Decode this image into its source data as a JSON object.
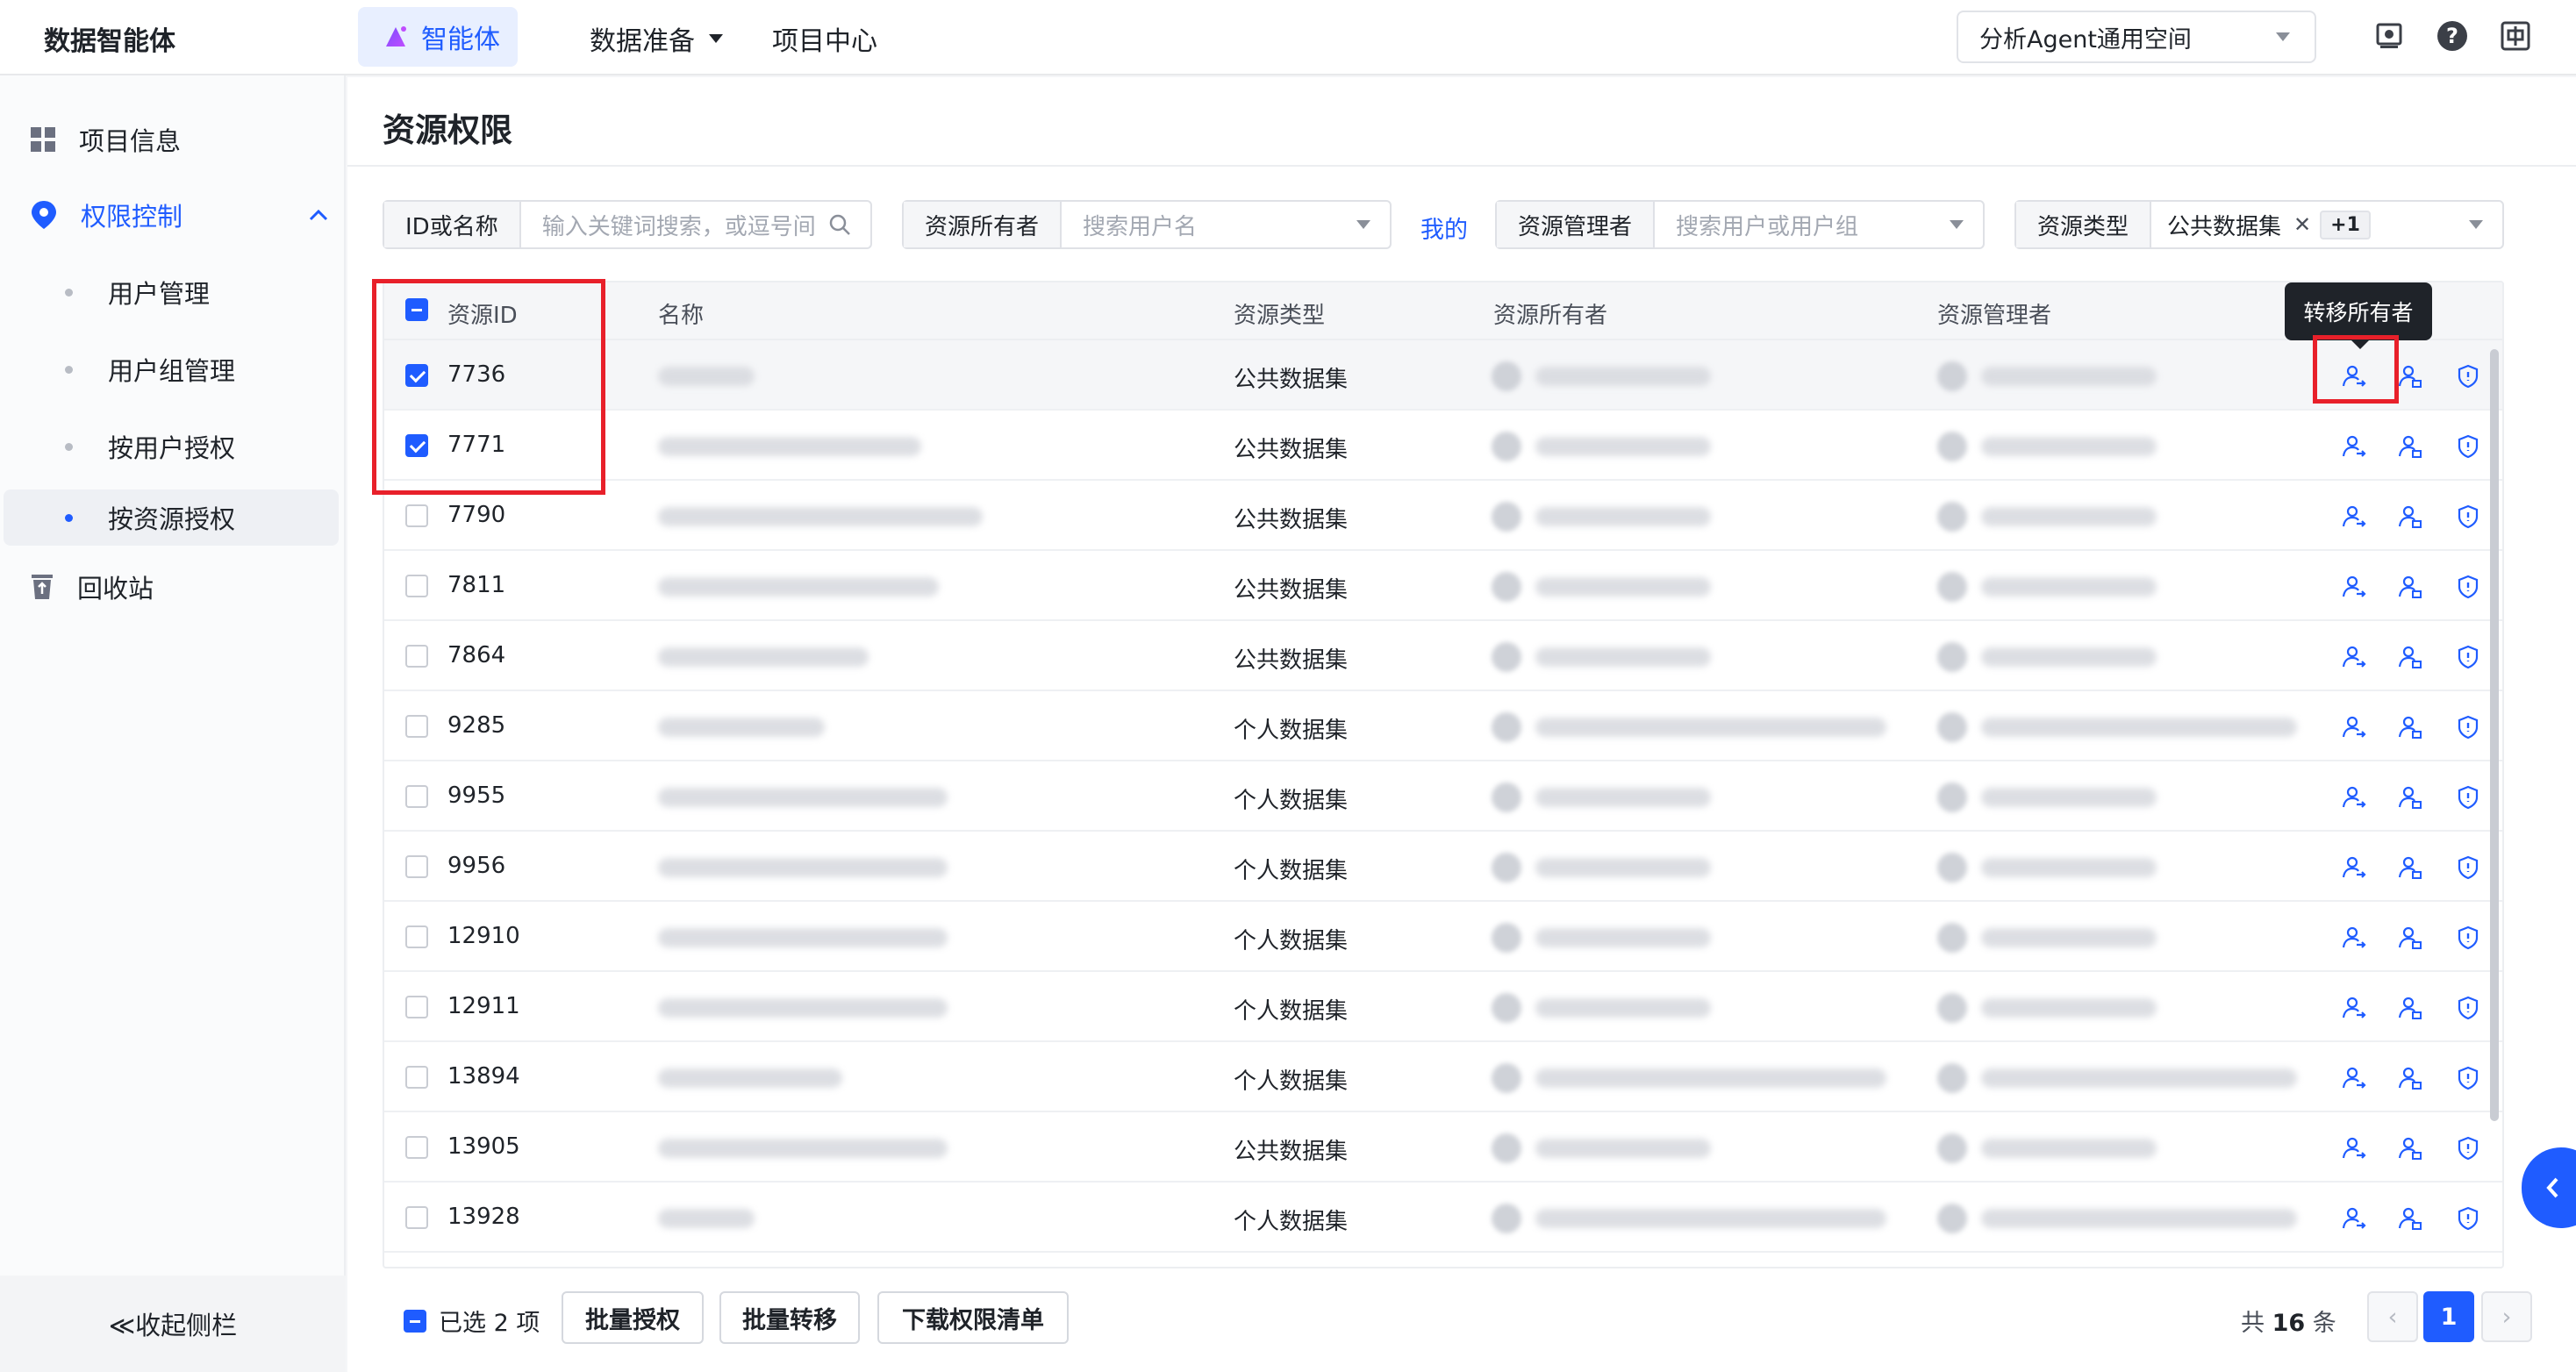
{
  "topbar": {
    "brand": "数据智能体",
    "nav": [
      {
        "label": "智能体",
        "active": true
      },
      {
        "label": "数据准备"
      },
      {
        "label": "项目中心"
      }
    ],
    "space": "分析Agent通用空间"
  },
  "sidebar": {
    "items": [
      {
        "label": "项目信息"
      },
      {
        "label": "权限控制"
      },
      {
        "label": "用户管理"
      },
      {
        "label": "用户组管理"
      },
      {
        "label": "按用户授权"
      },
      {
        "label": "按资源授权"
      },
      {
        "label": "回收站"
      }
    ],
    "collapse": "≪收起侧栏"
  },
  "main": {
    "title": "资源权限",
    "filters": {
      "id_name_label": "ID或名称",
      "id_name_placeholder": "输入关键词搜索，或逗号间",
      "owner_label": "资源所有者",
      "owner_placeholder": "搜索用户名",
      "mine": "我的",
      "manager_label": "资源管理者",
      "manager_placeholder": "搜索用户或用户组",
      "type_label": "资源类型",
      "type_tag": "公共数据集",
      "type_more": "+1"
    },
    "table": {
      "headers": [
        "资源ID",
        "名称",
        "资源类型",
        "资源所有者",
        "资源管理者"
      ],
      "rows": [
        {
          "id": "7736",
          "type": "公共数据集",
          "checked": true
        },
        {
          "id": "7771",
          "type": "公共数据集",
          "checked": true
        },
        {
          "id": "7790",
          "type": "公共数据集"
        },
        {
          "id": "7811",
          "type": "公共数据集"
        },
        {
          "id": "7864",
          "type": "公共数据集"
        },
        {
          "id": "9285",
          "type": "个人数据集"
        },
        {
          "id": "9955",
          "type": "个人数据集"
        },
        {
          "id": "9956",
          "type": "个人数据集"
        },
        {
          "id": "12910",
          "type": "个人数据集"
        },
        {
          "id": "12911",
          "type": "个人数据集"
        },
        {
          "id": "13894",
          "type": "个人数据集"
        },
        {
          "id": "13905",
          "type": "公共数据集"
        },
        {
          "id": "13928",
          "type": "个人数据集"
        }
      ]
    },
    "tooltip": "转移所有者"
  },
  "footer": {
    "selected": "已选 2 项",
    "batch_grant": "批量授权",
    "batch_transfer": "批量转移",
    "download": "下载权限清单",
    "total_prefix": "共",
    "total_count": "16",
    "total_suffix": "条",
    "current_page": "1"
  },
  "colors": {
    "accent": "#1f5cff",
    "highlight": "#e8202a"
  }
}
